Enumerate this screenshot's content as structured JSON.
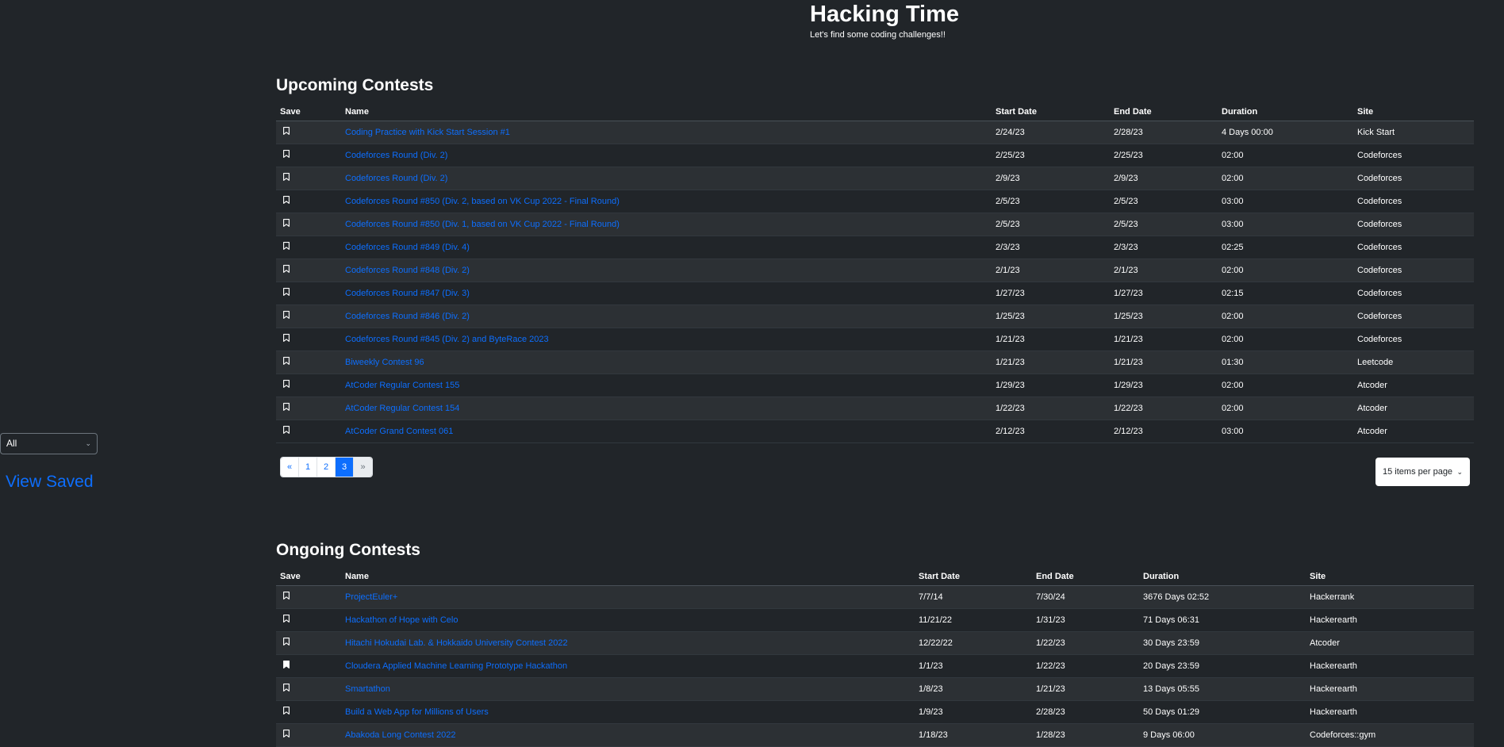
{
  "header": {
    "title": "Hacking Time",
    "subtitle": "Let's find some coding challenges!!"
  },
  "sidebar": {
    "filter_value": "All",
    "view_saved_label": "View Saved"
  },
  "upcoming": {
    "title": "Upcoming Contests",
    "columns": [
      "Save",
      "Name",
      "Start Date",
      "End Date",
      "Duration",
      "Site"
    ],
    "rows": [
      {
        "name": "Coding Practice with Kick Start Session #1",
        "start": "2/24/23",
        "end": "2/28/23",
        "duration": "4 Days 00:00",
        "site": "Kick Start",
        "saved": false
      },
      {
        "name": "Codeforces Round (Div. 2)",
        "start": "2/25/23",
        "end": "2/25/23",
        "duration": "02:00",
        "site": "Codeforces",
        "saved": false
      },
      {
        "name": "Codeforces Round (Div. 2)",
        "start": "2/9/23",
        "end": "2/9/23",
        "duration": "02:00",
        "site": "Codeforces",
        "saved": false
      },
      {
        "name": "Codeforces Round #850 (Div. 2, based on VK Cup 2022 - Final Round)",
        "start": "2/5/23",
        "end": "2/5/23",
        "duration": "03:00",
        "site": "Codeforces",
        "saved": false
      },
      {
        "name": "Codeforces Round #850 (Div. 1, based on VK Cup 2022 - Final Round)",
        "start": "2/5/23",
        "end": "2/5/23",
        "duration": "03:00",
        "site": "Codeforces",
        "saved": false
      },
      {
        "name": "Codeforces Round #849 (Div. 4)",
        "start": "2/3/23",
        "end": "2/3/23",
        "duration": "02:25",
        "site": "Codeforces",
        "saved": false
      },
      {
        "name": "Codeforces Round #848 (Div. 2)",
        "start": "2/1/23",
        "end": "2/1/23",
        "duration": "02:00",
        "site": "Codeforces",
        "saved": false
      },
      {
        "name": "Codeforces Round #847 (Div. 3)",
        "start": "1/27/23",
        "end": "1/27/23",
        "duration": "02:15",
        "site": "Codeforces",
        "saved": false
      },
      {
        "name": "Codeforces Round #846 (Div. 2)",
        "start": "1/25/23",
        "end": "1/25/23",
        "duration": "02:00",
        "site": "Codeforces",
        "saved": false
      },
      {
        "name": "Codeforces Round #845 (Div. 2) and ByteRace 2023",
        "start": "1/21/23",
        "end": "1/21/23",
        "duration": "02:00",
        "site": "Codeforces",
        "saved": false
      },
      {
        "name": "Biweekly Contest 96",
        "start": "1/21/23",
        "end": "1/21/23",
        "duration": "01:30",
        "site": "Leetcode",
        "saved": false
      },
      {
        "name": "AtCoder Regular Contest 155",
        "start": "1/29/23",
        "end": "1/29/23",
        "duration": "02:00",
        "site": "Atcoder",
        "saved": false
      },
      {
        "name": "AtCoder Regular Contest 154",
        "start": "1/22/23",
        "end": "1/22/23",
        "duration": "02:00",
        "site": "Atcoder",
        "saved": false
      },
      {
        "name": "AtCoder Grand Contest 061",
        "start": "2/12/23",
        "end": "2/12/23",
        "duration": "03:00",
        "site": "Atcoder",
        "saved": false
      }
    ],
    "pagination": {
      "prev": "«",
      "pages": [
        "1",
        "2",
        "3"
      ],
      "active_page": "3",
      "next": "»"
    },
    "per_page_label": "15 items per page"
  },
  "ongoing": {
    "title": "Ongoing Contests",
    "columns": [
      "Save",
      "Name",
      "Start Date",
      "End Date",
      "Duration",
      "Site"
    ],
    "rows": [
      {
        "name": "ProjectEuler+",
        "start": "7/7/14",
        "end": "7/30/24",
        "duration": "3676 Days 02:52",
        "site": "Hackerrank",
        "saved": false
      },
      {
        "name": "Hackathon of Hope with Celo",
        "start": "11/21/22",
        "end": "1/31/23",
        "duration": "71 Days 06:31",
        "site": "Hackerearth",
        "saved": false
      },
      {
        "name": "Hitachi Hokudai Lab. & Hokkaido University Contest 2022",
        "start": "12/22/22",
        "end": "1/22/23",
        "duration": "30 Days 23:59",
        "site": "Atcoder",
        "saved": false
      },
      {
        "name": "Cloudera Applied Machine Learning Prototype Hackathon",
        "start": "1/1/23",
        "end": "1/22/23",
        "duration": "20 Days 23:59",
        "site": "Hackerearth",
        "saved": true
      },
      {
        "name": "Smartathon",
        "start": "1/8/23",
        "end": "1/21/23",
        "duration": "13 Days 05:55",
        "site": "Hackerearth",
        "saved": false
      },
      {
        "name": "Build a Web App for Millions of Users",
        "start": "1/9/23",
        "end": "2/28/23",
        "duration": "50 Days 01:29",
        "site": "Hackerearth",
        "saved": false
      },
      {
        "name": "Abakoda Long Contest 2022",
        "start": "1/18/23",
        "end": "1/28/23",
        "duration": "9 Days 06:00",
        "site": "Codeforces::gym",
        "saved": false
      }
    ]
  }
}
